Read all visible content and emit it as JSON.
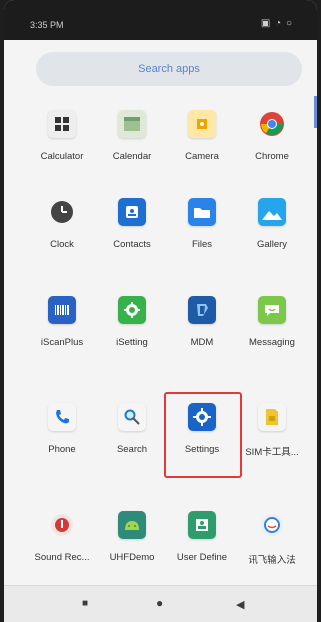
{
  "status": {
    "time": "3:35 PM",
    "icons": "▣ ◔ ○"
  },
  "search": {
    "placeholder": "Search apps"
  },
  "apps": [
    {
      "label": "Calculator"
    },
    {
      "label": "Calendar"
    },
    {
      "label": "Camera"
    },
    {
      "label": "Chrome"
    },
    {
      "label": "Clock"
    },
    {
      "label": "Contacts"
    },
    {
      "label": "Files"
    },
    {
      "label": "Gallery"
    },
    {
      "label": "iScanPlus"
    },
    {
      "label": "iSetting"
    },
    {
      "label": "MDM"
    },
    {
      "label": "Messaging"
    },
    {
      "label": "Phone"
    },
    {
      "label": "Search"
    },
    {
      "label": "Settings"
    },
    {
      "label": "SIM卡工具..."
    },
    {
      "label": "Sound Rec..."
    },
    {
      "label": "UHFDemo"
    },
    {
      "label": "User Define"
    },
    {
      "label": "讯飞输入法"
    }
  ],
  "highlight": {
    "target": "Settings",
    "color": "#e23a3a"
  },
  "nav": {
    "back": "◀",
    "home": "●",
    "recents": "■"
  }
}
